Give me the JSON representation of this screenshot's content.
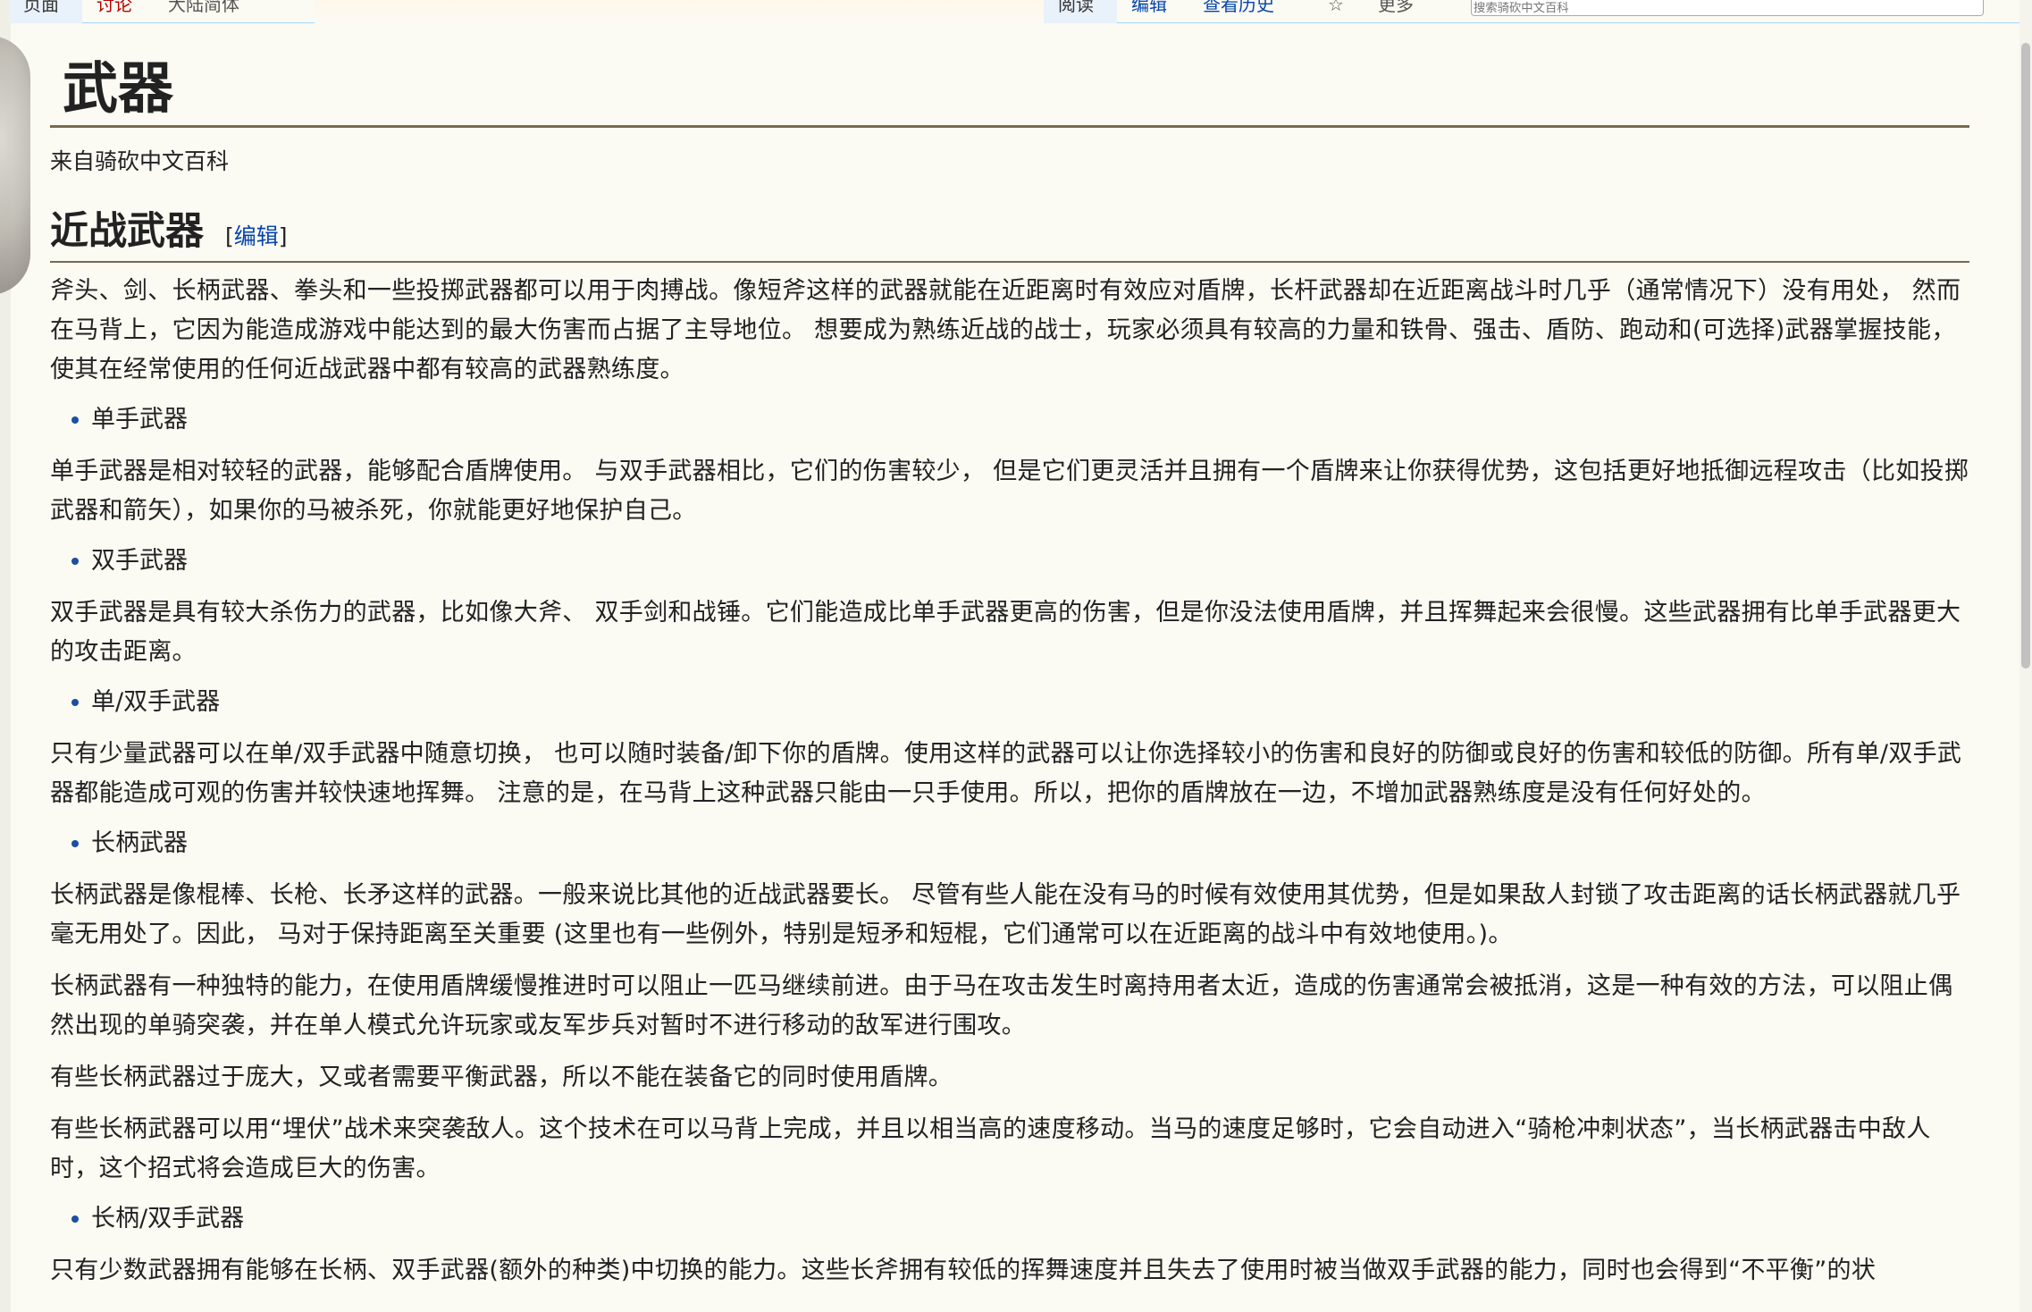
{
  "tabs": {
    "left": [
      {
        "label": "页面",
        "state": "selected"
      },
      {
        "label": "讨论",
        "state": "new"
      },
      {
        "label": "大陆简体",
        "state": "plain"
      }
    ],
    "right": [
      {
        "label": "阅读",
        "state": "selected"
      },
      {
        "label": "编辑",
        "state": "link"
      },
      {
        "label": "查看历史",
        "state": "link"
      },
      {
        "label": "☆",
        "state": "plain"
      },
      {
        "label": "更多",
        "state": "plain"
      }
    ],
    "search_placeholder": "搜索骑砍中文百科"
  },
  "page": {
    "title": "武器",
    "site_sub": "来自骑砍中文百科"
  },
  "section": {
    "title": "近战武器",
    "edit_open": "[",
    "edit_label": "编辑",
    "edit_close": "]"
  },
  "body": {
    "intro_1": "斧头、剑、长柄武器、拳头和一些投掷武器都可以用于肉搏战。像短斧这样的武器就能在近距离时有效应对盾牌，长杆武器却在近距离战斗时几乎（通常情况下）没有用处， 然而在马背上，它因为能造成游戏中能达到的最大伤害而占据了主导地位。 想要成为熟练近战的战士，玩家必须具有较高的力量和铁骨、强击、盾防、跑动和(可选择)武器掌握技能，使其在经常使用的任何近战武器中都有较高的武器熟练度。",
    "bullet_one_hand": "单手武器",
    "one_hand": "单手武器是相对较轻的武器，能够配合盾牌使用。 与双手武器相比，它们的伤害较少， 但是它们更灵活并且拥有一个盾牌来让你获得优势，这包括更好地抵御远程攻击（比如投掷武器和箭矢），如果你的马被杀死，你就能更好地保护自己。",
    "bullet_two_hand": "双手武器",
    "two_hand": "双手武器是具有较大杀伤力的武器，比如像大斧、 双手剑和战锤。它们能造成比单手武器更高的伤害，但是你没法使用盾牌，并且挥舞起来会很慢。这些武器拥有比单手武器更大的攻击距离。",
    "bullet_one_two": "单/双手武器",
    "one_two": "只有少量武器可以在单/双手武器中随意切换， 也可以随时装备/卸下你的盾牌。使用这样的武器可以让你选择较小的伤害和良好的防御或良好的伤害和较低的防御。所有单/双手武器都能造成可观的伤害并较快速地挥舞。 注意的是，在马背上这种武器只能由一只手使用。所以，把你的盾牌放在一边，不增加武器熟练度是没有任何好处的。",
    "bullet_polearm": "长柄武器",
    "polearm_1": "长柄武器是像棍棒、长枪、长矛这样的武器。一般来说比其他的近战武器要长。 尽管有些人能在没有马的时候有效使用其优势，但是如果敌人封锁了攻击距离的话长柄武器就几乎毫无用处了。因此， 马对于保持距离至关重要 (这里也有一些例外，特别是短矛和短棍，它们通常可以在近距离的战斗中有效地使用。)。",
    "polearm_2": "长柄武器有一种独特的能力，在使用盾牌缓慢推进时可以阻止一匹马继续前进。由于马在攻击发生时离持用者太近，造成的伤害通常会被抵消，这是一种有效的方法，可以阻止偶然出现的单骑突袭，并在单人模式允许玩家或友军步兵对暂时不进行移动的敌军进行围攻。",
    "polearm_3": "有些长柄武器过于庞大，又或者需要平衡武器，所以不能在装备它的同时使用盾牌。",
    "polearm_4": "有些长柄武器可以用“埋伏”战术来突袭敌人。这个技术在可以马背上完成，并且以相当高的速度移动。当马的速度足够时，它会自动进入“骑枪冲刺状态”，当长柄武器击中敌人时，这个招式将会造成巨大的伤害。",
    "bullet_polearm_two": "长柄/双手武器",
    "polearm_two": "只有少数武器拥有能够在长柄、双手武器(额外的种类)中切换的能力。这些长斧拥有较低的挥舞速度并且失去了使用时被当做双手武器的能力，同时也会得到“不平衡”的状"
  }
}
